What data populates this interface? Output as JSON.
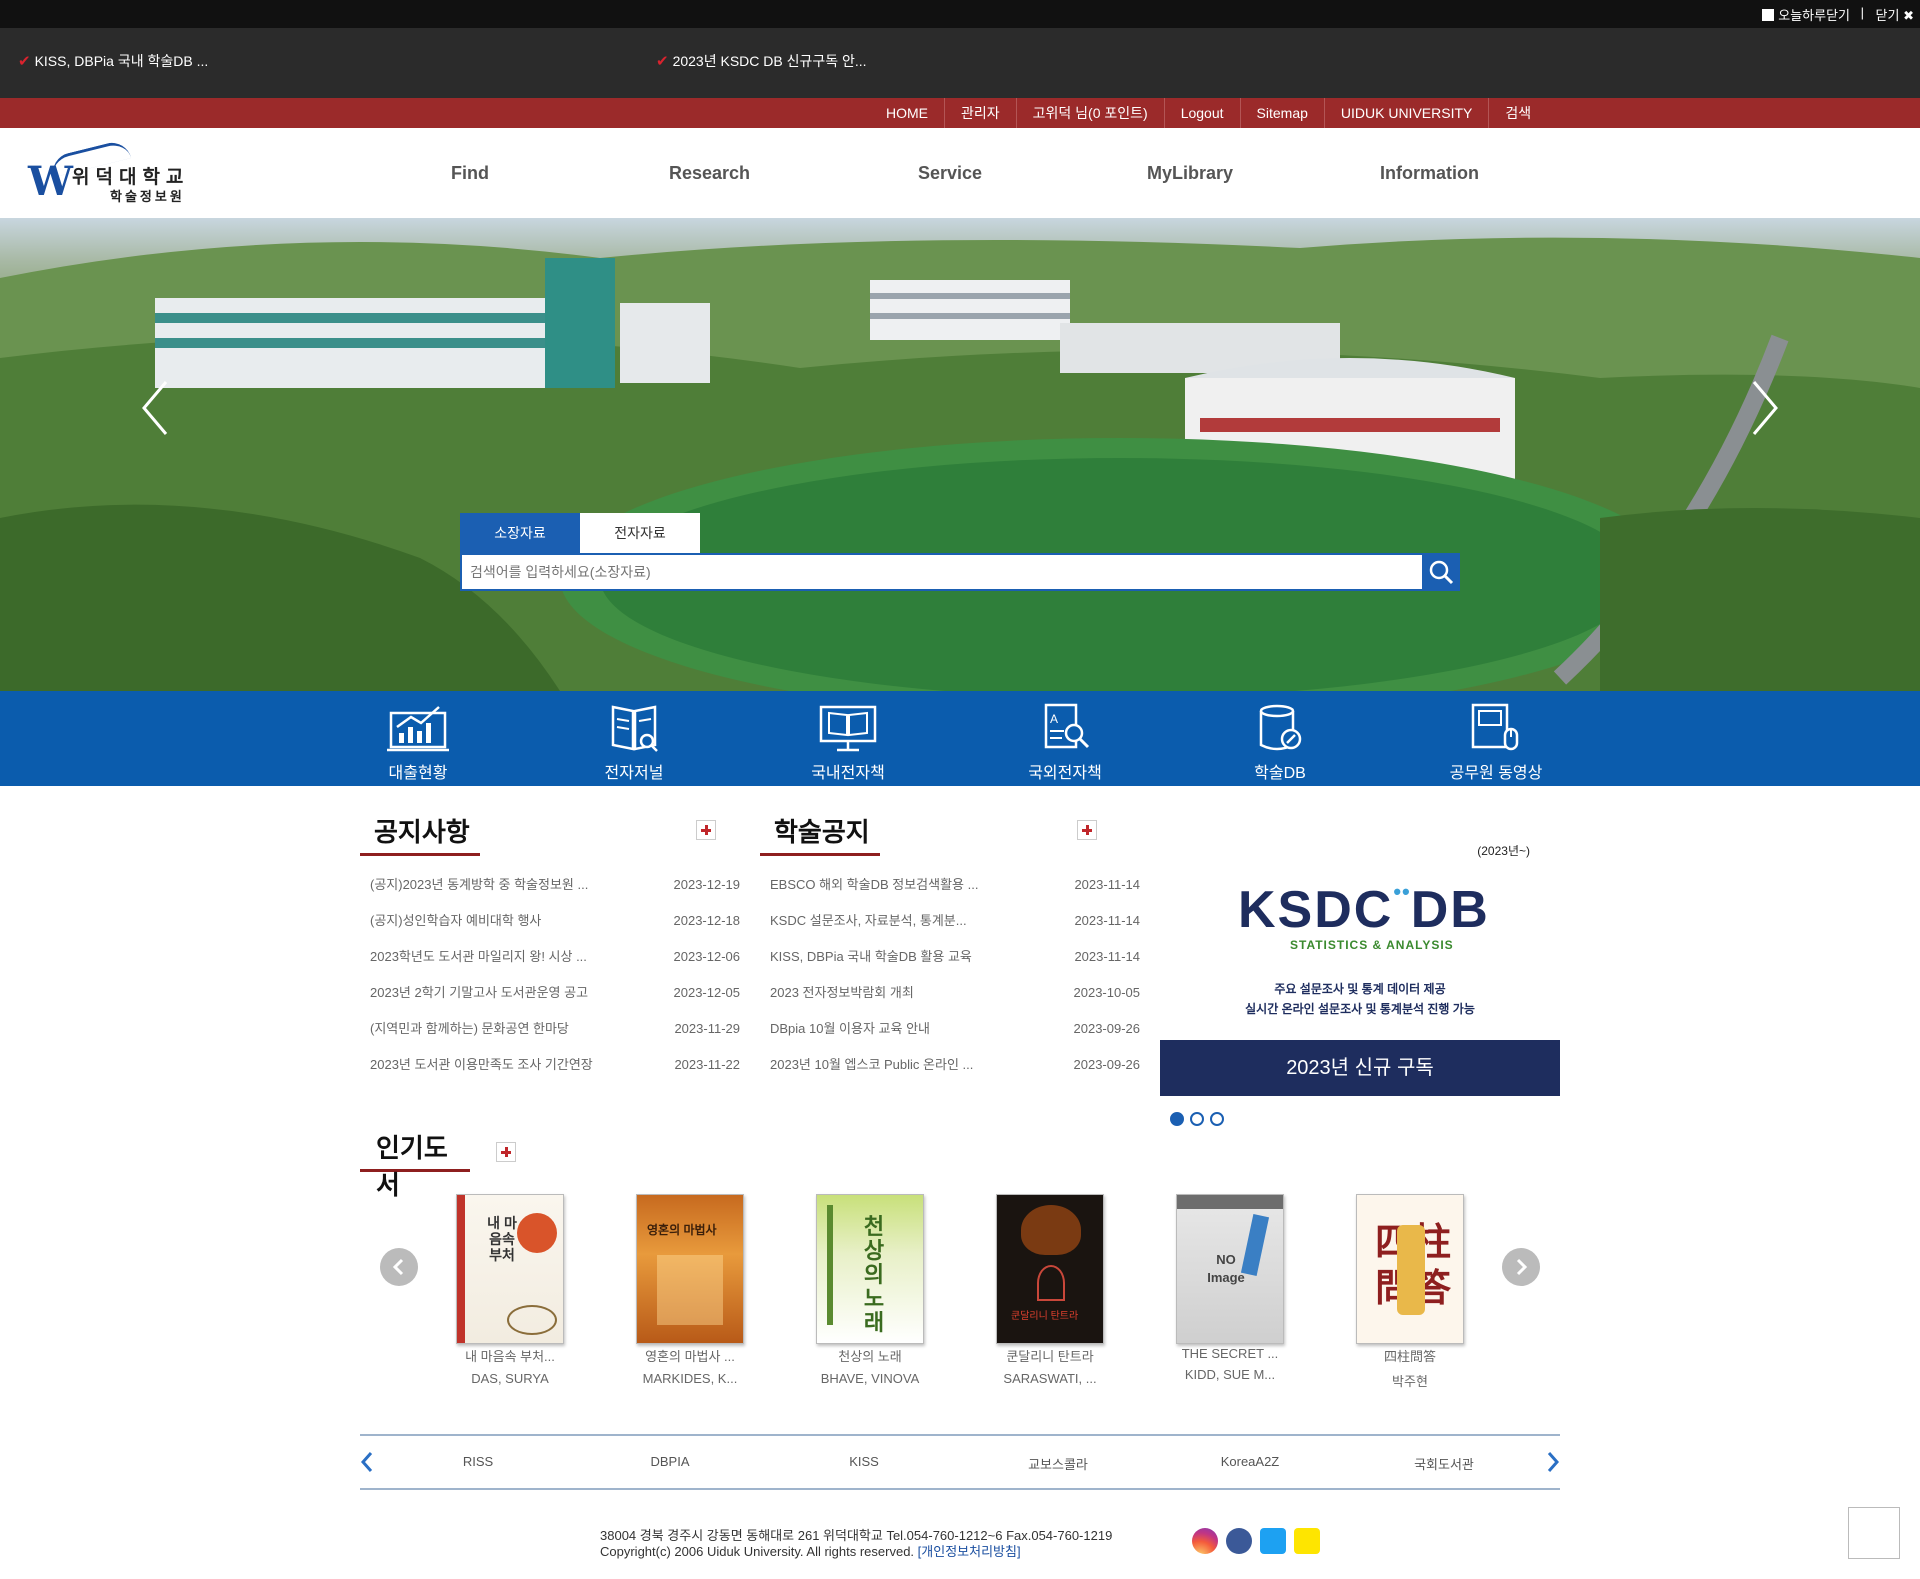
{
  "topbar": {
    "today_close": "오늘하루닫기",
    "separator": "|",
    "close": "닫기"
  },
  "ticker": [
    {
      "text": "KISS, DBPia 국내 학술DB ..."
    },
    {
      "text": "2023년 KSDC DB 신규구독 안..."
    }
  ],
  "util_menu": [
    "HOME",
    "관리자",
    "고위덕 님(0 포인트)",
    "Logout",
    "Sitemap",
    "UIDUK UNIVERSITY",
    "검색"
  ],
  "logo": {
    "mark": "W",
    "name": "위덕대학교",
    "sub": "학술정보원"
  },
  "gnb": [
    "Find",
    "Research",
    "Service",
    "MyLibrary",
    "Information"
  ],
  "search": {
    "tabs": [
      "소장자료",
      "전자자료"
    ],
    "placeholder": "검색어를 입력하세요(소장자료)"
  },
  "quick_menu": [
    "대출현황",
    "전자저널",
    "국내전자책",
    "국외전자책",
    "학술DB",
    "공무원 동영상"
  ],
  "notice": {
    "title": "공지사항",
    "items": [
      {
        "title": "(공지)2023년 동계방학 중 학술정보원 ...",
        "date": "2023-12-19"
      },
      {
        "title": "(공지)성인학습자 예비대학 행사",
        "date": "2023-12-18"
      },
      {
        "title": "2023학년도 도서관 마일리지 왕! 시상 ...",
        "date": "2023-12-06"
      },
      {
        "title": "2023년 2학기 기말고사 도서관운영 공고",
        "date": "2023-12-05"
      },
      {
        "title": "(지역민과 함께하는) 문화공연 한마당",
        "date": "2023-11-29"
      },
      {
        "title": "2023년 도서관 이용만족도 조사 기간연장",
        "date": "2023-11-22"
      }
    ]
  },
  "academic": {
    "title": "학술공지",
    "items": [
      {
        "title": "EBSCO 해외 학술DB 정보검색활용 ...",
        "date": "2023-11-14"
      },
      {
        "title": "KSDC 설문조사, 자료분석, 통계분...",
        "date": "2023-11-14"
      },
      {
        "title": "KISS, DBPia 국내 학술DB 활용 교육",
        "date": "2023-11-14"
      },
      {
        "title": "2023 전자정보박람회 개최",
        "date": "2023-10-05"
      },
      {
        "title": "DBpia 10월 이용자 교육 안내",
        "date": "2023-09-26"
      },
      {
        "title": "2023년 10월 엡스코 Public 온라인 ...",
        "date": "2023-09-26"
      }
    ]
  },
  "banner": {
    "year": "(2023년~)",
    "logo_a": "KSDC",
    "logo_dots": "••",
    "logo_b": "DB",
    "tagline": "STATISTICS & ANALYSIS",
    "desc1": "주요 설문조사 및 통계 데이터 제공",
    "desc2": "실시간 온라인 설문조사 및 통계분석 진행 가능",
    "cta": "2023년 신규 구독"
  },
  "popular": {
    "title": "인기도서",
    "books": [
      {
        "title": "내 마음속 부처...",
        "author": "DAS, SURYA",
        "cover_text": "내 마음속 부처"
      },
      {
        "title": "영혼의 마법사 ...",
        "author": "MARKIDES, K...",
        "cover_text": "영혼의 마법사"
      },
      {
        "title": "천상의 노래",
        "author": "BHAVE, VINOVA",
        "cover_text": "천상의 노래"
      },
      {
        "title": "쿤달리니 탄트라",
        "author": "SARASWATI, ...",
        "cover_text": "쿤달리니 탄트라"
      },
      {
        "title": "THE SECRET ...",
        "author": "KIDD, SUE M...",
        "cover_text": "NO Image"
      },
      {
        "title": "四柱問答",
        "author": "박주현",
        "cover_text": "四柱問答"
      }
    ]
  },
  "link_sites": [
    "RISS",
    "DBPIA",
    "KISS",
    "교보스콜라",
    "KoreaA2Z",
    "국회도서관"
  ],
  "footer": {
    "address": "38004 경북 경주시 강동면 동해대로 261 위덕대학교 Tel.054-760-1212~6 Fax.054-760-1219",
    "copyright": "Copyright(c) 2006 Uiduk University. All rights reserved.",
    "privacy": "[개인정보처리방침]"
  },
  "sns": [
    "instagram-icon",
    "facebook-icon",
    "twitter-icon",
    "kakao-icon"
  ],
  "colors": {
    "brand_blue": "#0b5cad",
    "brand_red": "#9b2a2a",
    "navy": "#1e2d5e"
  }
}
